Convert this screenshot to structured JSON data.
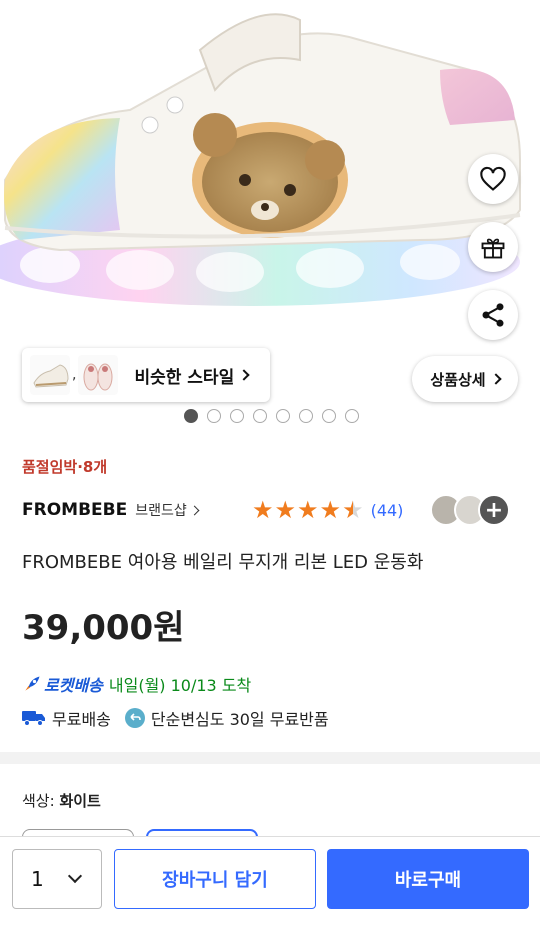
{
  "product_image": {
    "alt_icon": "sneaker-image"
  },
  "actions": {
    "wishlist_icon": "heart-icon",
    "gift_icon": "gift-icon",
    "share_icon": "share-icon"
  },
  "similar_style": {
    "separator": ",",
    "label": "비슷한 스타일"
  },
  "detail_button": {
    "label": "상품상세"
  },
  "carousel": {
    "count": 8,
    "active_index": 0
  },
  "stock_notice": "품절임박·8개",
  "brand": {
    "name": "FROMBEBE",
    "shop_label": "브랜드샵"
  },
  "rating": {
    "stars": 4.5,
    "count_text": "(44)"
  },
  "reviewers": {
    "plus_label": "+"
  },
  "product_title": "FROMBEBE 여아용 베일리 무지개 리본 LED 운동화",
  "price": "39,000원",
  "delivery": {
    "rocket_label": "로켓배송",
    "arrival": "내일(월) 10/13 도착",
    "free_shipping": "무료배송",
    "free_return": "단순변심도 30일 무료반품"
  },
  "option": {
    "label": "색상:",
    "value": "화이트"
  },
  "bottom_bar": {
    "quantity": "1",
    "cart_label": "장바구니 담기",
    "buy_label": "바로구매"
  },
  "colors": {
    "accent": "#346aff",
    "stock_red": "#c0392b",
    "rocket_green": "#0a8a1a",
    "star": "#f07c1e"
  }
}
